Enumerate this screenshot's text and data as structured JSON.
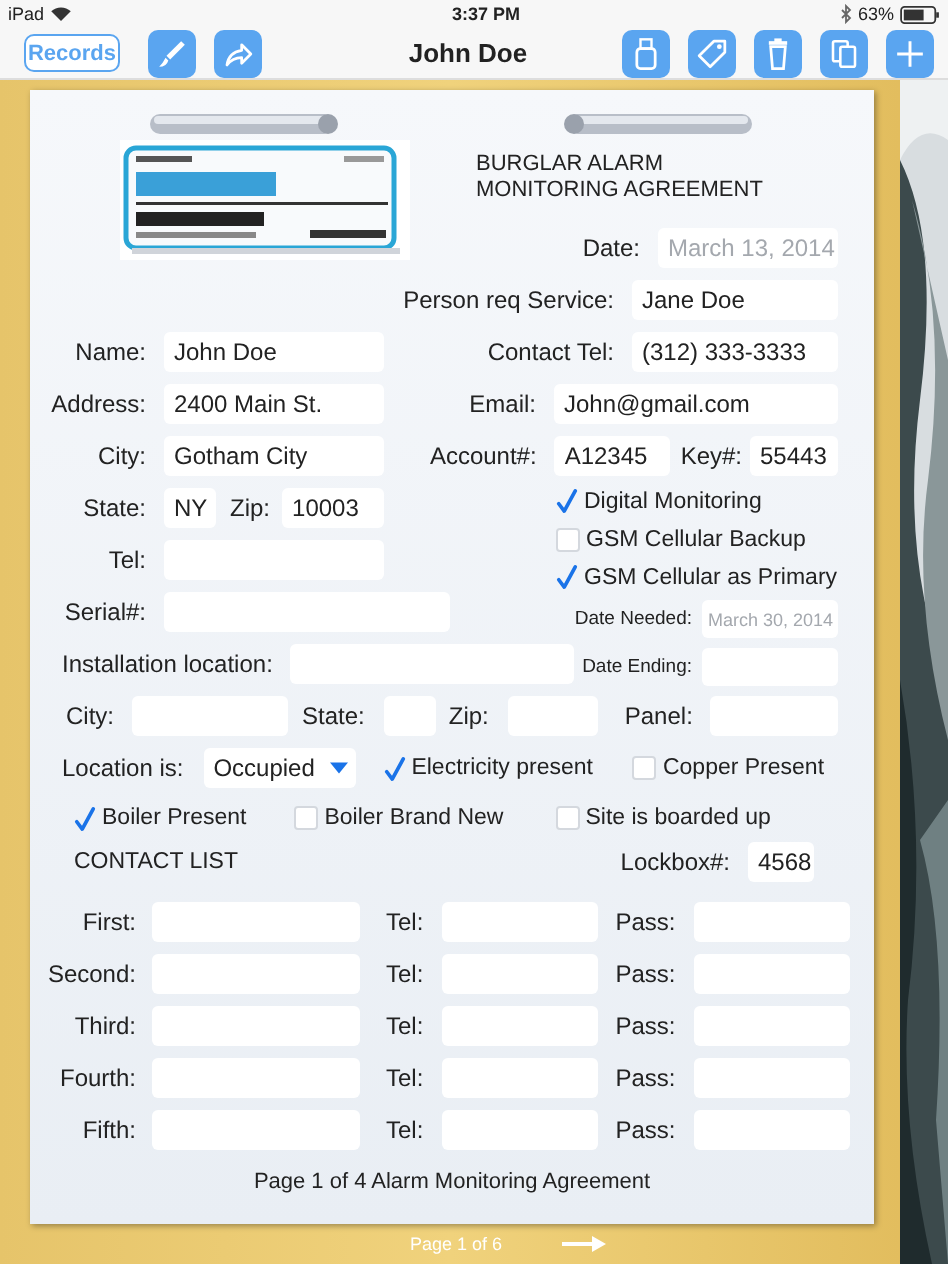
{
  "status_bar": {
    "carrier": "iPad",
    "time": "3:37 PM",
    "battery": "63%"
  },
  "toolbar": {
    "back_button": "Records",
    "title": "John Doe"
  },
  "form": {
    "heading": [
      "BURGLAR ALARM",
      "MONITORING AGREEMENT"
    ],
    "date": {
      "label": "Date:",
      "placeholder": "March 13, 2014"
    },
    "person_req_service": {
      "label": "Person req Service:",
      "value": "Jane Doe"
    },
    "name": {
      "label": "Name:",
      "value": "John Doe"
    },
    "contact_tel": {
      "label": "Contact Tel:",
      "value": "(312) 333-3333"
    },
    "address": {
      "label": "Address:",
      "value": "2400 Main St."
    },
    "email": {
      "label": "Email:",
      "value": "John@gmail.com"
    },
    "city": {
      "label": "City:",
      "value": "Gotham City"
    },
    "account": {
      "label": "Account#:",
      "value": "A12345"
    },
    "key": {
      "label": "Key#:",
      "value": "55443"
    },
    "state": {
      "label": "State:",
      "value": "NY"
    },
    "zip": {
      "label": "Zip:",
      "value": "10003"
    },
    "tel": {
      "label": "Tel:"
    },
    "serial": {
      "label": "Serial#:"
    },
    "installation_location": {
      "label": "Installation location:"
    },
    "monitoring_options": [
      {
        "label": "Digital Monitoring",
        "checked": true
      },
      {
        "label": "GSM Cellular Backup",
        "checked": false
      },
      {
        "label": "GSM Cellular as Primary",
        "checked": true
      }
    ],
    "date_needed": {
      "label": "Date Needed:",
      "placeholder": "March 30, 2014"
    },
    "date_ending": {
      "label": "Date Ending:"
    },
    "site_city": {
      "label": "City:"
    },
    "site_state": {
      "label": "State:"
    },
    "site_zip": {
      "label": "Zip:"
    },
    "panel": {
      "label": "Panel:"
    },
    "location_is": {
      "label": "Location is:",
      "value": "Occupied"
    },
    "site_options": [
      {
        "label": "Electricity present",
        "checked": true
      },
      {
        "label": "Copper Present",
        "checked": false
      },
      {
        "label": "Boiler Present",
        "checked": true
      },
      {
        "label": "Boiler Brand New",
        "checked": false
      },
      {
        "label": "Site is boarded up",
        "checked": false
      }
    ],
    "contact_list_title": "CONTACT LIST",
    "lockbox": {
      "label": "Lockbox#:",
      "value": "4568"
    },
    "contacts": [
      {
        "label": "First:",
        "tel_label": "Tel:",
        "pass_label": "Pass:"
      },
      {
        "label": "Second:",
        "tel_label": "Tel:",
        "pass_label": "Pass:"
      },
      {
        "label": "Third:",
        "tel_label": "Tel:",
        "pass_label": "Pass:"
      },
      {
        "label": "Fourth:",
        "tel_label": "Tel:",
        "pass_label": "Pass:"
      },
      {
        "label": "Fifth:",
        "tel_label": "Tel:",
        "pass_label": "Pass:"
      }
    ],
    "footer": "Page 1 of 4 Alarm Monitoring Agreement"
  },
  "pager": {
    "label": "Page 1 of 6"
  }
}
